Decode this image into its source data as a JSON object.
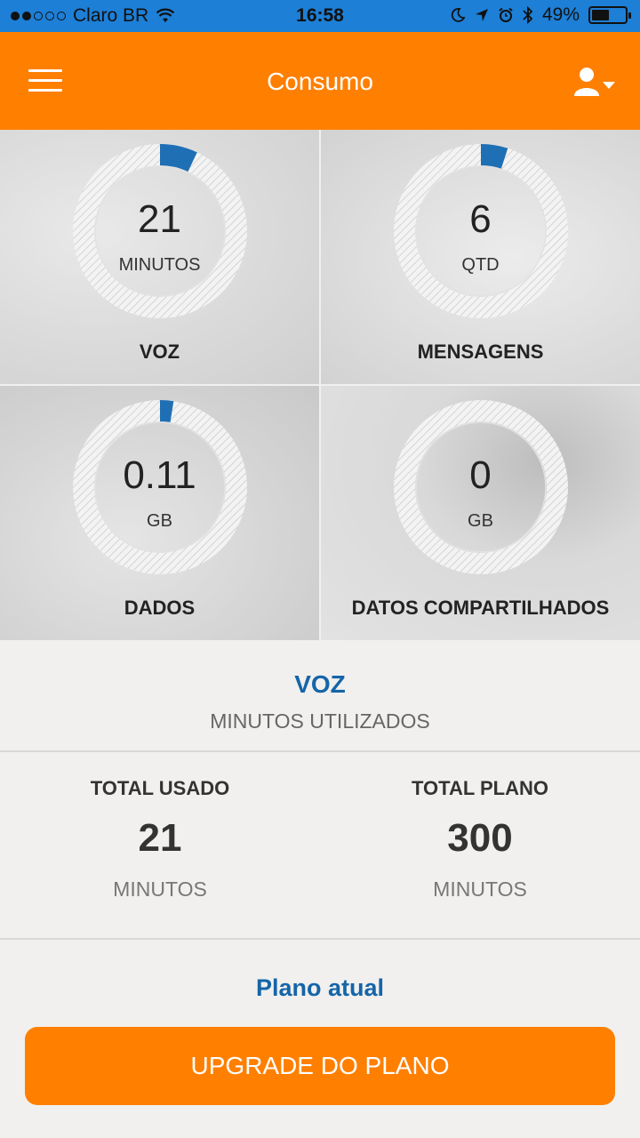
{
  "status_bar": {
    "carrier": "Claro BR",
    "time": "16:58",
    "battery": "49%"
  },
  "header": {
    "title": "Consumo",
    "menu_icon": "hamburger-menu-icon",
    "user_icon": "user-dropdown-icon"
  },
  "tiles": [
    {
      "value": "21",
      "unit": "MINUTOS",
      "label": "VOZ",
      "fraction": 0.07
    },
    {
      "value": "6",
      "unit": "QTD",
      "label": "MENSAGENS",
      "fraction": 0.05
    },
    {
      "value": "0.11",
      "unit": "GB",
      "label": "DADOS",
      "fraction": 0.025
    },
    {
      "value": "0",
      "unit": "GB",
      "label": "DATOS COMPARTILHADOS",
      "fraction": 0
    }
  ],
  "summary": {
    "title": "VOZ",
    "subtitle": "MINUTOS UTILIZADOS",
    "used": {
      "heading": "TOTAL USADO",
      "value": "21",
      "unit": "MINUTOS"
    },
    "plan": {
      "heading": "TOTAL PLANO",
      "value": "300",
      "unit": "MINUTOS"
    }
  },
  "plano_atual_label": "Plano atual",
  "upgrade_button_label": "UPGRADE DO PLANO",
  "colors": {
    "accent_orange": "#ff7f00",
    "gauge_blue": "#1f6fb5",
    "link_blue": "#1565a8"
  }
}
